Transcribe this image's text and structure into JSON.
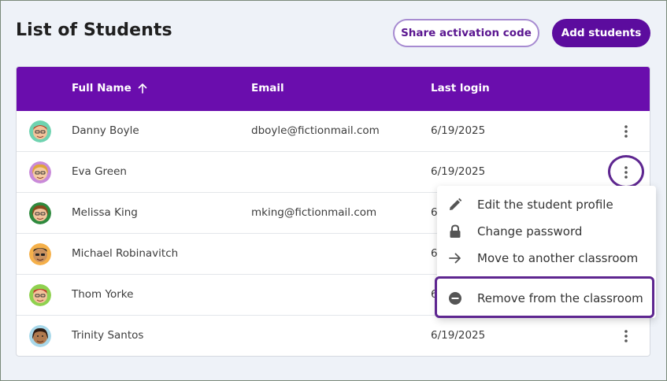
{
  "header": {
    "title": "List of Students",
    "share_label": "Share activation code",
    "add_label": "Add students"
  },
  "table": {
    "columns": {
      "name": "Full Name",
      "email": "Email",
      "login": "Last login"
    },
    "sort": "ascending",
    "rows": [
      {
        "name": "Danny Boyle",
        "email": "dboyle@fictionmail.com",
        "login": "6/19/2025"
      },
      {
        "name": "Eva Green",
        "email": "",
        "login": "6/19/2025"
      },
      {
        "name": "Melissa King",
        "email": "mking@fictionmail.com",
        "login": "6"
      },
      {
        "name": "Michael Robinavitch",
        "email": "",
        "login": "6"
      },
      {
        "name": "Thom Yorke",
        "email": "",
        "login": "6"
      },
      {
        "name": "Trinity Santos",
        "email": "",
        "login": "6/19/2025"
      }
    ]
  },
  "menu": {
    "items": [
      {
        "label": "Edit the student profile",
        "icon": "pencil-icon"
      },
      {
        "label": "Change password",
        "icon": "lock-icon"
      },
      {
        "label": "Move to another classroom",
        "icon": "arrow-right-icon"
      },
      {
        "label": "Remove from the classroom",
        "icon": "minus-circle-icon"
      }
    ]
  },
  "colors": {
    "accent": "#6a0dad",
    "button": "#5c0c9e",
    "highlight": "#5e2690",
    "background": "#eef2f8"
  }
}
